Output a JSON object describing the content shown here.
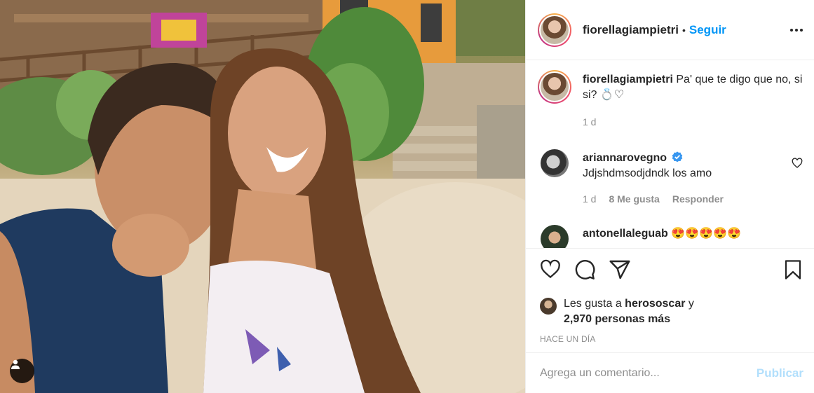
{
  "post": {
    "author": "fiorellagiampietri",
    "follow_label": "Seguir",
    "separator": "•"
  },
  "caption": {
    "username": "fiorellagiampietri",
    "text": "Pa' que te digo que no, si si? 💍♡",
    "age": "1 d"
  },
  "comments": [
    {
      "username": "ariannarovegno",
      "verified": true,
      "text": "Jdjshdmsodjdndk los amo",
      "age": "1 d",
      "likes": "8 Me gusta",
      "reply_label": "Responder"
    },
    {
      "username": "antonellaleguab",
      "text": "😍😍😍😍😍"
    }
  ],
  "likes": {
    "prefix": "Les gusta a ",
    "user": "herososcar",
    "suffix": " y",
    "count": "2,970 personas más"
  },
  "timestamp": "HACE UN DÍA",
  "composer": {
    "placeholder": "Agrega un comentario...",
    "publish_label": "Publicar"
  },
  "icons": {
    "more": "more-options-icon",
    "like": "heart-icon",
    "comment": "comment-icon",
    "share": "share-icon",
    "save": "bookmark-icon",
    "tag": "user-tag-icon",
    "verified": "verified-badge-icon"
  },
  "colors": {
    "accent": "#0095f6",
    "publish_disabled": "#b2dffc",
    "muted": "#8e8e8e",
    "text": "#262626"
  }
}
